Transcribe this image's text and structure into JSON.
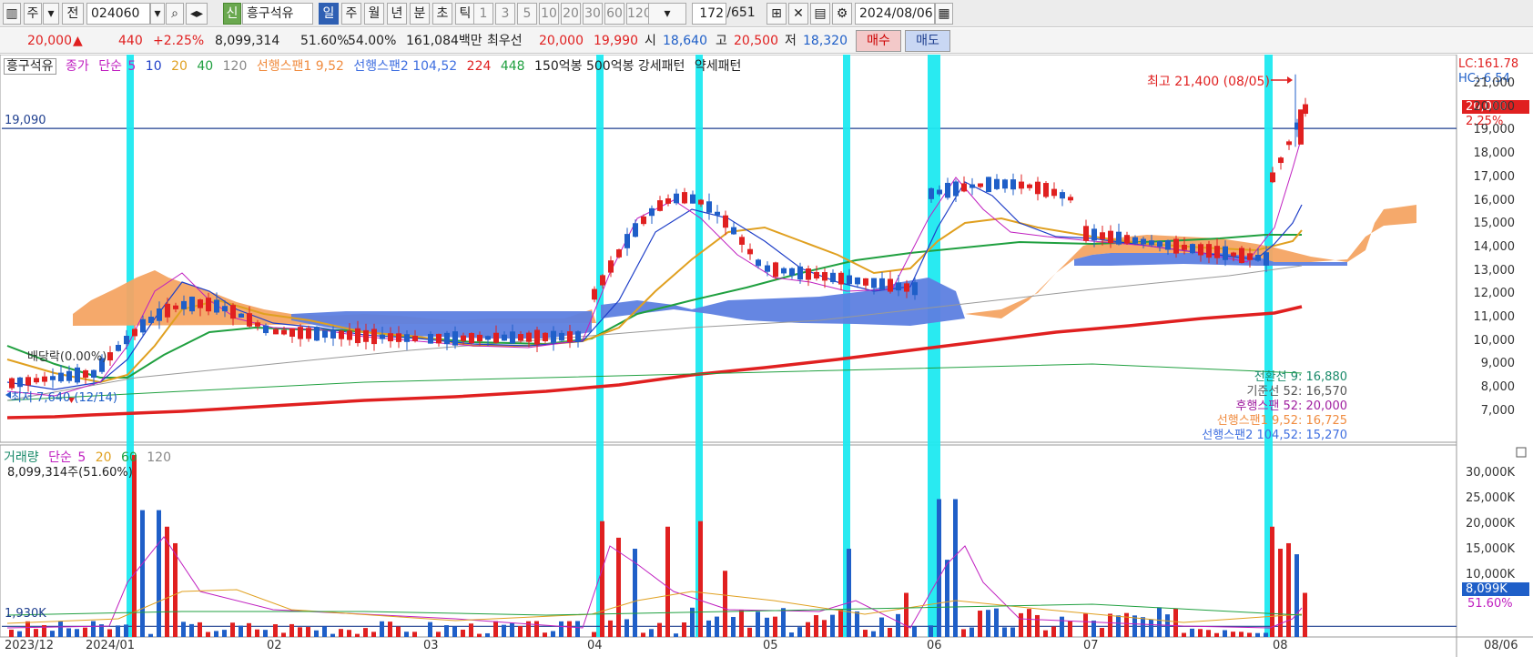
{
  "toolbar": {
    "period_kind": "주",
    "prev_label": "전",
    "code": "024060",
    "credit_badge": "신",
    "stock_name": "흥구석유",
    "periods": [
      "일",
      "주",
      "월",
      "년",
      "분",
      "초",
      "틱"
    ],
    "active_period": "일",
    "intervals": [
      "1",
      "3",
      "5",
      "10",
      "20",
      "30",
      "60",
      "120"
    ],
    "count_value": "172",
    "count_total": "/651",
    "date": "2024/08/06"
  },
  "quote": {
    "price": "20,000",
    "change": "440",
    "change_rate": "+2.25%",
    "volume": "8,099,314",
    "turnover1": "51.60%",
    "turnover2": "54.00%",
    "amount": "161,084백만",
    "best_label": "최우선",
    "ask": "20,000",
    "bid": "19,990",
    "open_label": "시",
    "open": "18,640",
    "high_label": "고",
    "high": "20,500",
    "low_label": "저",
    "low": "18,320",
    "buy_label": "매수",
    "sell_label": "매도"
  },
  "legend": {
    "stock": "흥구석유",
    "close_label": "종가",
    "ma_label": "단순",
    "ma5": "5",
    "ma10": "10",
    "ma20": "20",
    "ma40": "40",
    "ma120": "120",
    "span1": "선행스팬1 9,52",
    "span2": "선행스팬2 104,52",
    "ma224": "224",
    "ma448": "448",
    "volume_patterns": "150억봉 500억봉 강세패턴",
    "weak_pattern": "약세패턴"
  },
  "annotations": {
    "hline_label": "19,090",
    "high_label": "최고 21,400 (08/05)",
    "low_label": "최저 7,640 (12/14)",
    "dividend_label": "배당락(0.00%)",
    "lc": "LC:161.78",
    "hc": "HC:-6.54",
    "last_price": "20,000",
    "last_pct": "2.25%",
    "vol_line_label": "1,930K",
    "vol_last": "8,099K",
    "vol_last_pct": "51.60%"
  },
  "ichimoku": {
    "conversion": "전환선 9: 16,880",
    "base": "기준선 52: 16,570",
    "lagging": "후행스팬 52: 20,000",
    "lead1": "선행스팬1 9,52: 16,725",
    "lead2": "선행스팬2 104,52: 15,270"
  },
  "price_axis": [
    "21,000",
    "20,000",
    "19,000",
    "18,000",
    "17,000",
    "16,000",
    "15,000",
    "14,000",
    "13,000",
    "12,000",
    "11,000",
    "10,000",
    "9,000",
    "8,000",
    "7,000"
  ],
  "volume_legend": {
    "label": "거래량",
    "ma_label": "단순",
    "ma5": "5",
    "ma20": "20",
    "ma60": "60",
    "ma120": "120",
    "current": "8,099,314주(51.60%)"
  },
  "volume_axis": [
    "30,000K",
    "25,000K",
    "20,000K",
    "15,000K",
    "10,000K"
  ],
  "x_axis": [
    "2023/12",
    "2024/01",
    "02",
    "03",
    "04",
    "05",
    "06",
    "07",
    "08"
  ],
  "x_axis_right": "08/06",
  "chart_data": {
    "type": "candlestick",
    "dates_range": [
      "2023/12",
      "2024/08/06"
    ],
    "price_range": [
      6500,
      21500
    ],
    "candles_approx": [
      {
        "month": "2023/12",
        "close": 8400
      },
      {
        "month": "2024/01",
        "close": 12100
      },
      {
        "month": "2024/02",
        "close": 10300
      },
      {
        "month": "2024/03",
        "close": 10000
      },
      {
        "month": "2024/04",
        "close": 15200
      },
      {
        "month": "2024/05",
        "close": 12300
      },
      {
        "month": "2024/06",
        "close": 14500
      },
      {
        "month": "2024/07",
        "close": 13500
      },
      {
        "month": "2024/08",
        "close": 20000
      }
    ],
    "volume_range": [
      0,
      33000000
    ],
    "colors": {
      "up": "#e02020",
      "down": "#1f5fc8",
      "highlight": "#1ee9f0",
      "cloud_up": "#f4a463",
      "cloud_down": "#5d7fe0"
    }
  }
}
